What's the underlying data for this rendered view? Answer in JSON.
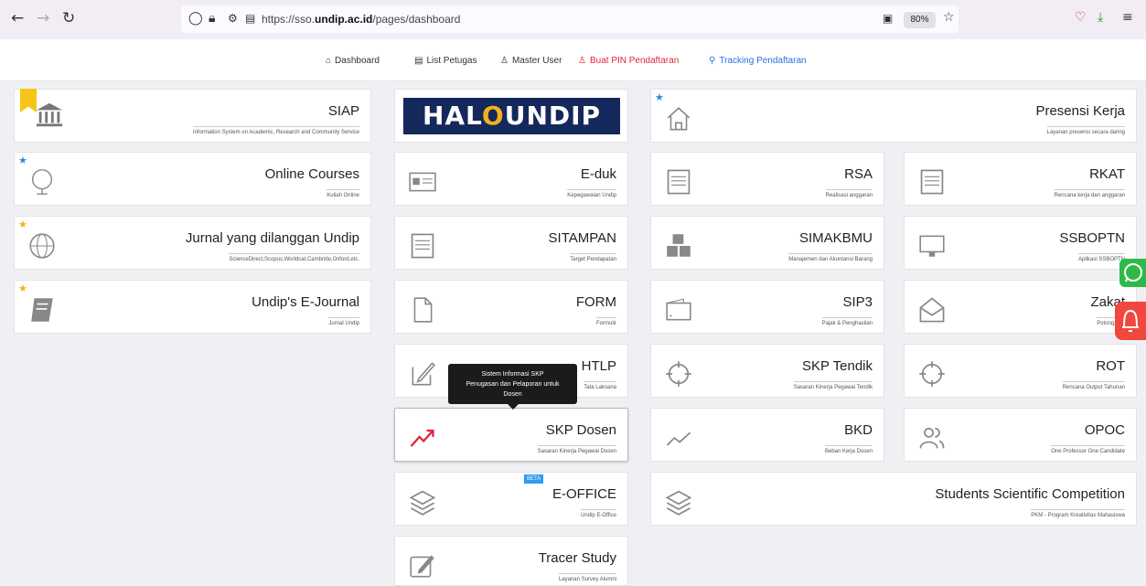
{
  "browser": {
    "url_prefix": "https://sso.",
    "url_domain": "undip.ac.id",
    "url_suffix": "/pages/dashboard",
    "zoom": "80%"
  },
  "nav": [
    {
      "label": "Dashboard",
      "icon": "home-icon"
    },
    {
      "label": "List Petugas",
      "icon": "list-icon"
    },
    {
      "label": "Master User",
      "icon": "user-icon"
    },
    {
      "label": "Buat PIN Pendaftaran",
      "icon": "user-add-icon",
      "color": "#e0243c"
    },
    {
      "label": "Tracking Pendaftaran",
      "icon": "search-icon",
      "color": "#2a6fe0"
    }
  ],
  "cards": {
    "siap": {
      "title": "SIAP",
      "sub": "Information System on Academic, Research and Community Service"
    },
    "halo": {
      "pre": "HAL",
      "o": "O",
      "post": "UNDIP"
    },
    "presensi": {
      "title": "Presensi Kerja",
      "sub": "Layanan presensi secara daring"
    },
    "online": {
      "title": "Online Courses",
      "sub": "Kuliah Online"
    },
    "eduk": {
      "title": "E-duk",
      "sub": "Kepegawaian Undip"
    },
    "rsa": {
      "title": "RSA",
      "sub": "Realisasi anggaran"
    },
    "rkat": {
      "title": "RKAT",
      "sub": "Rencana kerja dan anggaran"
    },
    "jurnal": {
      "title": "Jurnal yang dilanggan Undip",
      "sub": "ScienceDirect,Scopus,Worldcat,Cambride,Oxford,etc."
    },
    "sitampan": {
      "title": "SITAMPAN",
      "sub": "Target Pendapatan"
    },
    "simakbmu": {
      "title": "SIMAKBMU",
      "sub": "Manajemen dan Akuntansi Barang"
    },
    "ssboptn": {
      "title": "SSBOPTN",
      "sub": "Aplikasi SSBOPTN"
    },
    "ejournal": {
      "title": "Undip's E-Journal",
      "sub": "Jurnal Undip"
    },
    "form": {
      "title": "FORM",
      "sub": "Formulir"
    },
    "sip3": {
      "title": "SIP3",
      "sub": "Pajak & Penghasilan"
    },
    "zakat": {
      "title": "Zakat",
      "sub": "Potongan..."
    },
    "htlp": {
      "title": "HTLP",
      "sub": "Tata Laksana"
    },
    "skptendik": {
      "title": "SKP Tendik",
      "sub": "Sasaran Kinerja Pegawai Tendik"
    },
    "rot": {
      "title": "ROT",
      "sub": "Rencana Output Tahunan"
    },
    "skpdosen": {
      "title": "SKP Dosen",
      "sub": "Sasaran Kinerja Pegawai Dosen"
    },
    "bkd": {
      "title": "BKD",
      "sub": "Beban Kerja Dosen"
    },
    "opoc": {
      "title": "OPOC",
      "sub": "One Professor One Candidate"
    },
    "eoffice": {
      "title": "E-OFFICE",
      "sub": "Undip E-Office",
      "badge": "BETA"
    },
    "ssc": {
      "title": "Students Scientific Competition",
      "sub": "PKM - Program Kreativitas Mahasiswa"
    },
    "tracer": {
      "title": "Tracer Study",
      "sub": "Layanan Survey Alumni"
    }
  },
  "tooltip": {
    "line1": "Sistem Informasi SKP",
    "line2": "Penugasan dan Pelaporan untuk",
    "line3": "Dosen"
  }
}
